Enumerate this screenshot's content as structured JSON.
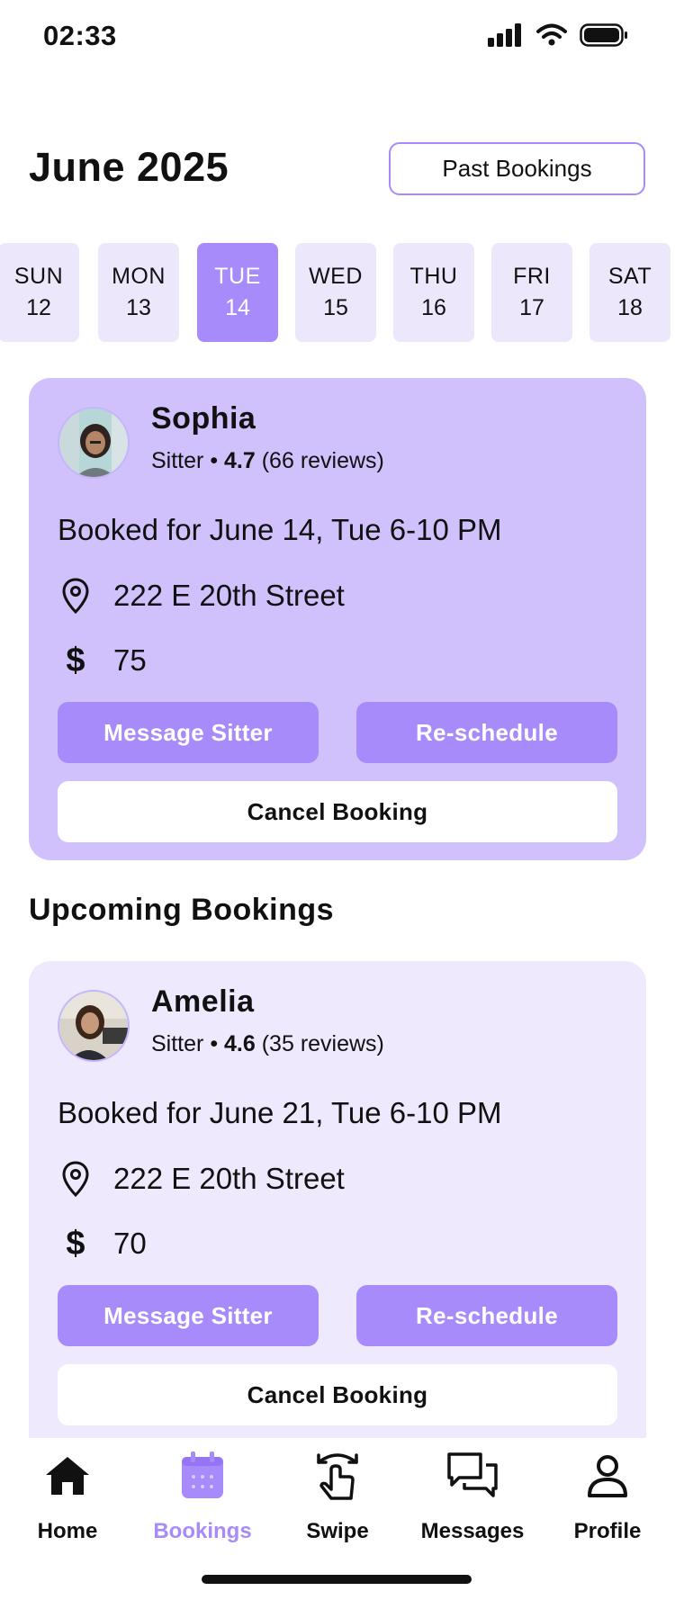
{
  "status_bar": {
    "time": "02:33"
  },
  "header": {
    "month_title": "June 2025",
    "past_bookings_label": "Past Bookings"
  },
  "days": [
    {
      "name": "SUN",
      "num": "12"
    },
    {
      "name": "MON",
      "num": "13"
    },
    {
      "name": "TUE",
      "num": "14",
      "selected": true
    },
    {
      "name": "WED",
      "num": "15"
    },
    {
      "name": "THU",
      "num": "16"
    },
    {
      "name": "FRI",
      "num": "17"
    },
    {
      "name": "SAT",
      "num": "18"
    }
  ],
  "current_booking": {
    "name": "Sophia",
    "role": "Sitter",
    "rating": "4.7",
    "reviews": "(66 reviews)",
    "booked_for": "Booked for June 14, Tue 6-10 PM",
    "address": "222 E 20th Street",
    "price": "75",
    "message_label": "Message Sitter",
    "reschedule_label": "Re-schedule",
    "cancel_label": "Cancel Booking"
  },
  "upcoming_heading": "Upcoming Bookings",
  "upcoming_booking": {
    "name": "Amelia",
    "role": "Sitter",
    "rating": "4.6",
    "reviews": "(35 reviews)",
    "booked_for": "Booked for June 21, Tue 6-10 PM",
    "address": "222 E 20th Street",
    "price": "70",
    "message_label": "Message Sitter",
    "reschedule_label": "Re-schedule",
    "cancel_label": "Cancel Booking"
  },
  "nav": {
    "home": "Home",
    "bookings": "Bookings",
    "swipe": "Swipe",
    "messages": "Messages",
    "profile": "Profile",
    "active": "bookings"
  },
  "colors": {
    "accent": "#a78bfa",
    "card_current": "#d0c0fc",
    "card_upcoming": "#efe9fe",
    "day_bg": "#ede7fc"
  }
}
